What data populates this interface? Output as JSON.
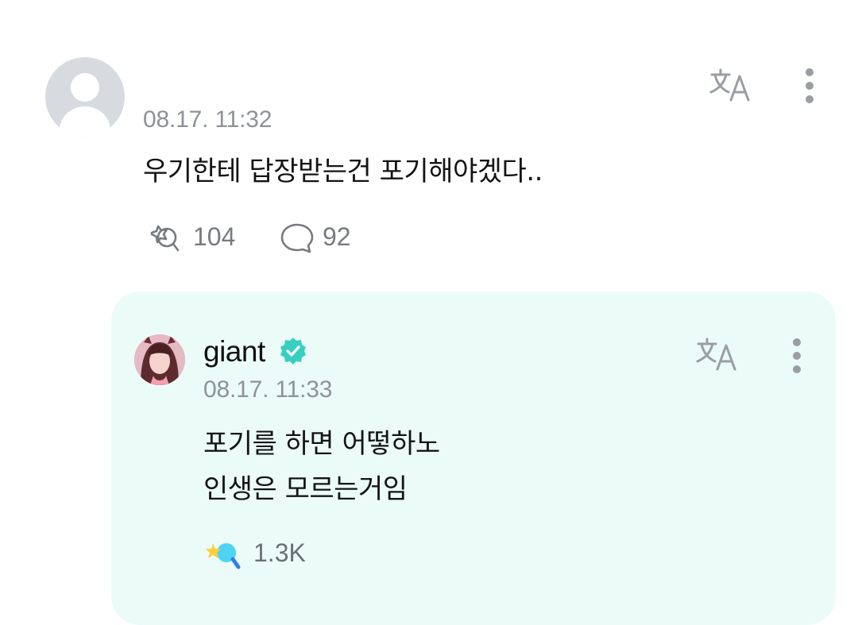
{
  "comment": {
    "timestamp": "08.17. 11:32",
    "text": "우기한테 답장받는건 포기해야겠다..",
    "like_count": "104",
    "reply_count": "92",
    "icons": {
      "avatar": "default-avatar-icon",
      "translate": "translate-icon",
      "more": "more-vertical-icon",
      "like": "like-icon",
      "reply": "reply-bubble-icon"
    }
  },
  "reply": {
    "author": "giant",
    "verified": true,
    "timestamp": "08.17. 11:33",
    "lines": [
      "포기를 하면 어떻하노",
      "인생은 모르는거임"
    ],
    "like_count": "1.3K",
    "icons": {
      "translate": "translate-icon",
      "more": "more-vertical-icon",
      "like": "like-filled-icon",
      "verified": "verified-badge-icon"
    }
  },
  "colors": {
    "reply_background": "#ebfcf8",
    "verified_badge": "#39cfc0",
    "muted_text": "#8e9298",
    "like_icon_fill": "#4fd3f2",
    "like_icon_star": "#ffcf3a"
  }
}
